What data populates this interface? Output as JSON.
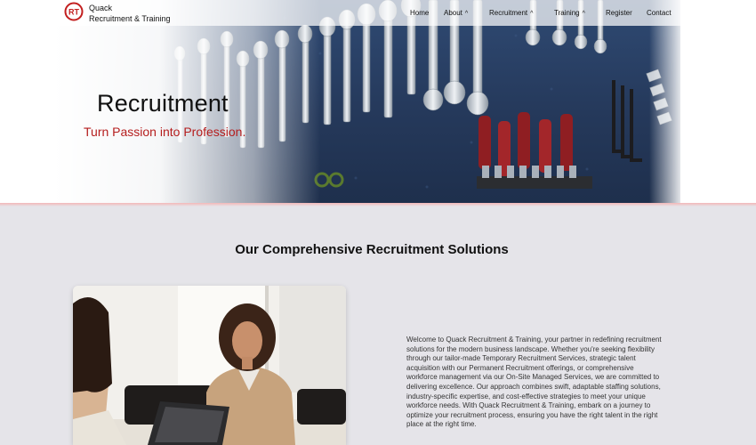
{
  "brand": {
    "logo_text": "RT",
    "line1": "Quack",
    "line2": "Recruitment & Training"
  },
  "nav": {
    "home": "Home",
    "about": "About",
    "recruitment": "Recruitment",
    "training": "Training",
    "register": "Register",
    "contact": "Contact",
    "caret": "^"
  },
  "hero": {
    "title": "Recruitment",
    "subtitle": "Turn Passion into Profession."
  },
  "section": {
    "title": "Our Comprehensive Recruitment Solutions",
    "description": "Welcome to Quack Recruitment & Training, your partner in redefining recruitment solutions for the modern business landscape. Whether you're seeking flexibility through our tailor-made Temporary Recruitment Services, strategic talent acquisition with our Permanent Recruitment offerings, or comprehensive workforce management via our On-Site Managed Services, we are committed to delivering excellence. Our approach combines swift, adaptable staffing solutions, industry-specific expertise, and cost-effective strategies to meet your unique workforce needs. With Quack Recruitment & Training, embark on a journey to optimize your recruitment process, ensuring you have the right talent in the right place at the right time."
  },
  "colors": {
    "accent": "#b51d1d",
    "background": "#e5e4e9",
    "hero_blue": "#2a4266"
  },
  "icons": [
    "logo-icon",
    "caret-down-icon"
  ]
}
